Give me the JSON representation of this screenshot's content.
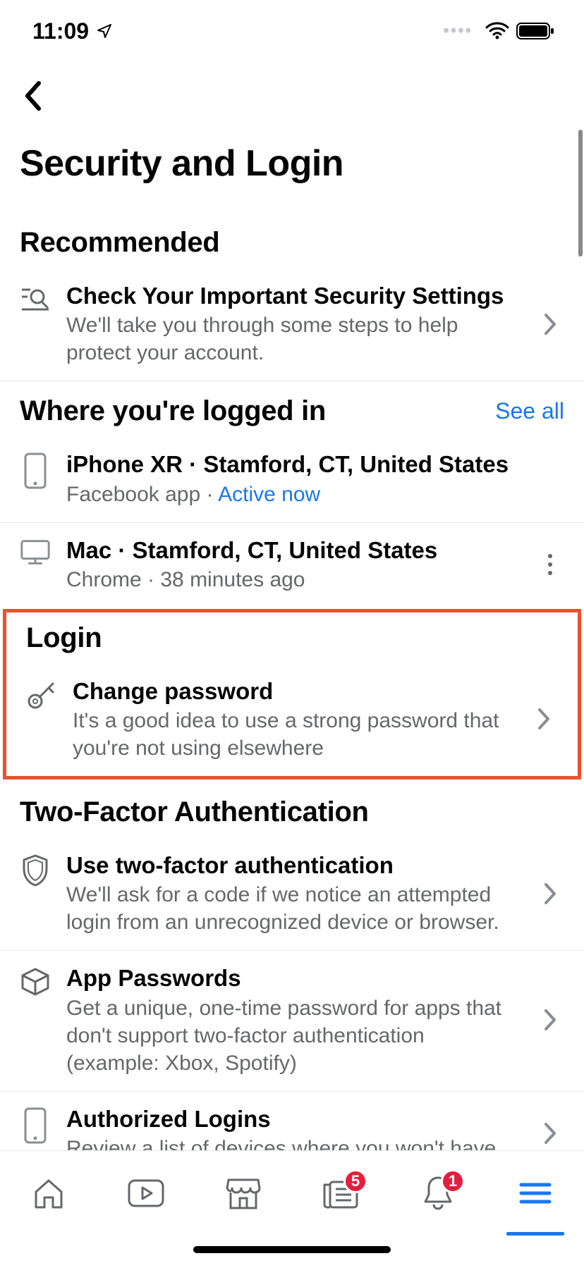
{
  "status": {
    "time": "11:09"
  },
  "page": {
    "title": "Security and Login"
  },
  "sections": {
    "recommended": {
      "title": "Recommended",
      "check": {
        "title": "Check Your Important Security Settings",
        "sub": "We'll take you through some steps to help protect your account."
      }
    },
    "logged_in": {
      "title": "Where you're logged in",
      "see_all": "See all",
      "s0": {
        "title": "iPhone XR · Stamford, CT, United States",
        "sub_app": "Facebook app",
        "sub_sep": " · ",
        "sub_active": "Active now"
      },
      "s1": {
        "title": "Mac · Stamford, CT, United States",
        "sub": "Chrome · 38 minutes ago"
      }
    },
    "login": {
      "title": "Login",
      "change_pw": {
        "title": "Change password",
        "sub": "It's a good idea to use a strong password that you're not using elsewhere"
      }
    },
    "twofa": {
      "title": "Two-Factor Authentication",
      "use": {
        "title": "Use two-factor authentication",
        "sub": "We'll ask for a code if we notice an attempted login from an unrecognized device or browser."
      },
      "app_pw": {
        "title": "App Passwords",
        "sub": "Get a unique, one-time password for apps that don't support two-factor authentication (example: Xbox, Spotify)"
      },
      "auth_logins": {
        "title": "Authorized Logins",
        "sub": "Review a list of devices where you won't have"
      }
    }
  },
  "tabs": {
    "news_badge": "5",
    "notif_badge": "1"
  }
}
